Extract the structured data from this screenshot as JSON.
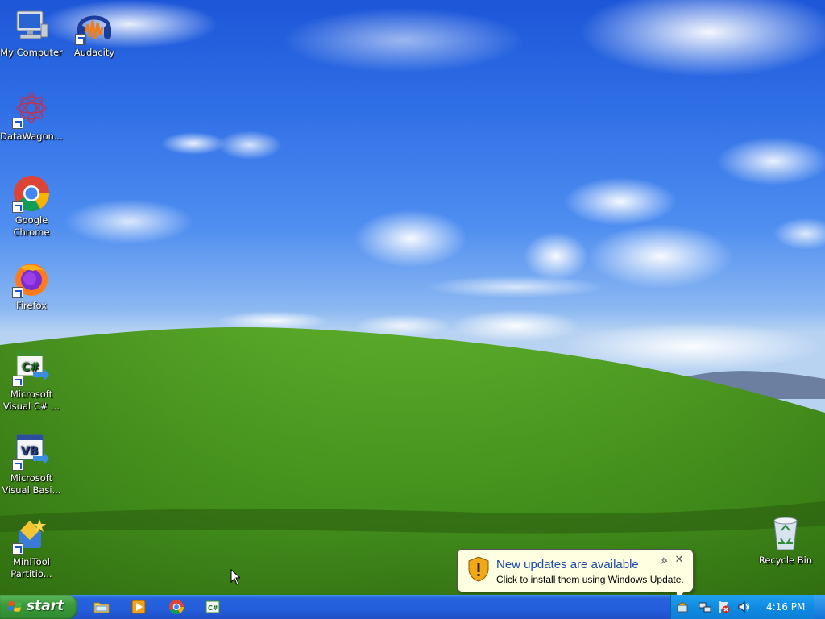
{
  "desktop": {
    "icons": [
      {
        "label_line1": "My Computer",
        "label_line2": ""
      },
      {
        "label_line1": "Audacity",
        "label_line2": ""
      },
      {
        "label_line1": "DataWagon...",
        "label_line2": ""
      },
      {
        "label_line1": "Google",
        "label_line2": "Chrome"
      },
      {
        "label_line1": "Firefox",
        "label_line2": ""
      },
      {
        "label_line1": "Microsoft",
        "label_line2": "Visual C# ..."
      },
      {
        "label_line1": "Microsoft",
        "label_line2": "Visual Basi..."
      },
      {
        "label_line1": "MiniTool",
        "label_line2": "Partitio..."
      },
      {
        "label_line1": "Recycle Bin",
        "label_line2": ""
      }
    ]
  },
  "taskbar": {
    "start_label": "start",
    "quick_launch": [
      "folder-icon",
      "media-player-icon",
      "chrome-icon",
      "visual-csharp-icon"
    ],
    "tray_icons": [
      "windows-update-icon",
      "network-icon",
      "security-alert-icon",
      "volume-icon"
    ],
    "clock": "4:16 PM"
  },
  "notification": {
    "title": "New updates are available",
    "body": "Click to install them using Windows Update.",
    "close_symbol": "✕"
  }
}
